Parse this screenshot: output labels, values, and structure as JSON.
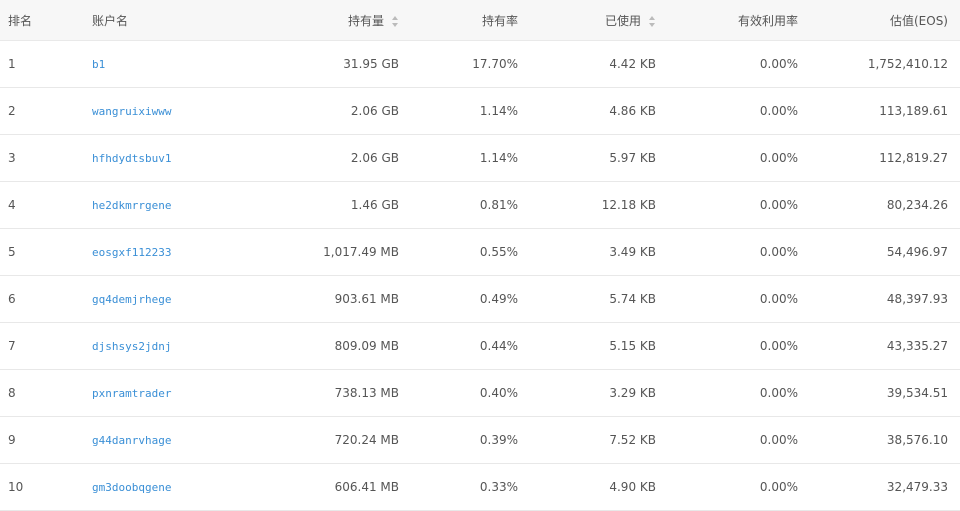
{
  "table": {
    "headers": {
      "rank": "排名",
      "account": "账户名",
      "holding": "持有量",
      "holding_rate": "持有率",
      "used": "已使用",
      "effective_rate": "有效利用率",
      "value": "估值(EOS)"
    },
    "sort_icons": [
      "sort-icon",
      "sort-icon"
    ],
    "rows": [
      {
        "rank": "1",
        "account": "b1",
        "holding": "31.95 GB",
        "holding_rate": "17.70%",
        "used": "4.42 KB",
        "effective_rate": "0.00%",
        "value": "1,752,410.12"
      },
      {
        "rank": "2",
        "account": "wangruixiwww",
        "holding": "2.06 GB",
        "holding_rate": "1.14%",
        "used": "4.86 KB",
        "effective_rate": "0.00%",
        "value": "113,189.61"
      },
      {
        "rank": "3",
        "account": "hfhdydtsbuv1",
        "holding": "2.06 GB",
        "holding_rate": "1.14%",
        "used": "5.97 KB",
        "effective_rate": "0.00%",
        "value": "112,819.27"
      },
      {
        "rank": "4",
        "account": "he2dkmrrgene",
        "holding": "1.46 GB",
        "holding_rate": "0.81%",
        "used": "12.18 KB",
        "effective_rate": "0.00%",
        "value": "80,234.26"
      },
      {
        "rank": "5",
        "account": "eosgxf112233",
        "holding": "1,017.49 MB",
        "holding_rate": "0.55%",
        "used": "3.49 KB",
        "effective_rate": "0.00%",
        "value": "54,496.97"
      },
      {
        "rank": "6",
        "account": "gq4demjrhege",
        "holding": "903.61 MB",
        "holding_rate": "0.49%",
        "used": "5.74 KB",
        "effective_rate": "0.00%",
        "value": "48,397.93"
      },
      {
        "rank": "7",
        "account": "djshsys2jdnj",
        "holding": "809.09 MB",
        "holding_rate": "0.44%",
        "used": "5.15 KB",
        "effective_rate": "0.00%",
        "value": "43,335.27"
      },
      {
        "rank": "8",
        "account": "pxnramtrader",
        "holding": "738.13 MB",
        "holding_rate": "0.40%",
        "used": "3.29 KB",
        "effective_rate": "0.00%",
        "value": "39,534.51"
      },
      {
        "rank": "9",
        "account": "g44danrvhage",
        "holding": "720.24 MB",
        "holding_rate": "0.39%",
        "used": "7.52 KB",
        "effective_rate": "0.00%",
        "value": "38,576.10"
      },
      {
        "rank": "10",
        "account": "gm3doobqgene",
        "holding": "606.41 MB",
        "holding_rate": "0.33%",
        "used": "4.90 KB",
        "effective_rate": "0.00%",
        "value": "32,479.33"
      }
    ]
  },
  "colors": {
    "link": "#3a8fd6",
    "header_bg": "#f7f7f7",
    "divider": "#e8e8e8"
  }
}
